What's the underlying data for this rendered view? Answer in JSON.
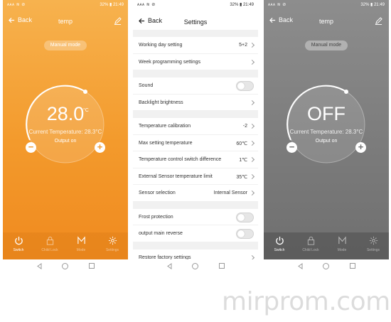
{
  "status": {
    "left": "ᴀᴀᴀ ≋ ⊘",
    "right": "32% ▮ 21:49"
  },
  "left_panel": {
    "back_label": "Back",
    "title": "temp",
    "mode": "Manual mode",
    "temperature": "28.0",
    "unit": "°C",
    "current_temperature": "Current Temperature: 28.3°C",
    "output": "Output on",
    "tabs": [
      {
        "label": "Switch",
        "icon": "power-icon"
      },
      {
        "label": "Child Lock",
        "icon": "lock-icon"
      },
      {
        "label": "Mode",
        "icon": "mode-m-icon"
      },
      {
        "label": "Settings",
        "icon": "gear-icon"
      }
    ]
  },
  "settings_panel": {
    "back_label": "Back",
    "title": "Settings",
    "rows": [
      {
        "label": "Working day setting",
        "value": "5+2"
      },
      {
        "label": "Week programming settings",
        "value": ""
      },
      {
        "label": "Sound",
        "toggle": false
      },
      {
        "label": "Backlight brightness",
        "value": ""
      },
      {
        "label": "Temperature calibration",
        "value": "-2"
      },
      {
        "label": "Max setting temperature",
        "value": "60℃"
      },
      {
        "label": "Temperature control switch difference",
        "value": "1℃"
      },
      {
        "label": "External Sensor temperature limit",
        "value": "35℃"
      },
      {
        "label": "Sensor selection",
        "value": "Internal Sensor"
      },
      {
        "label": "Frost protection",
        "toggle": false
      },
      {
        "label": "output main reverse",
        "toggle": false
      },
      {
        "label": "Restore factory settings",
        "value": ""
      }
    ]
  },
  "right_panel": {
    "back_label": "Back",
    "title": "temp",
    "mode": "Manual mode",
    "temperature": "OFF",
    "current_temperature": "Current Temperature: 28.3°C",
    "output": "Output on",
    "tabs": [
      {
        "label": "Switch",
        "icon": "power-icon"
      },
      {
        "label": "Child Lock",
        "icon": "lock-icon"
      },
      {
        "label": "Mode",
        "icon": "mode-m-icon"
      },
      {
        "label": "Settings",
        "icon": "gear-icon"
      }
    ]
  },
  "watermark": "mirprom.com",
  "colors": {
    "orange_accent": "#f39a2c",
    "gray_off": "#7c7c7c"
  }
}
